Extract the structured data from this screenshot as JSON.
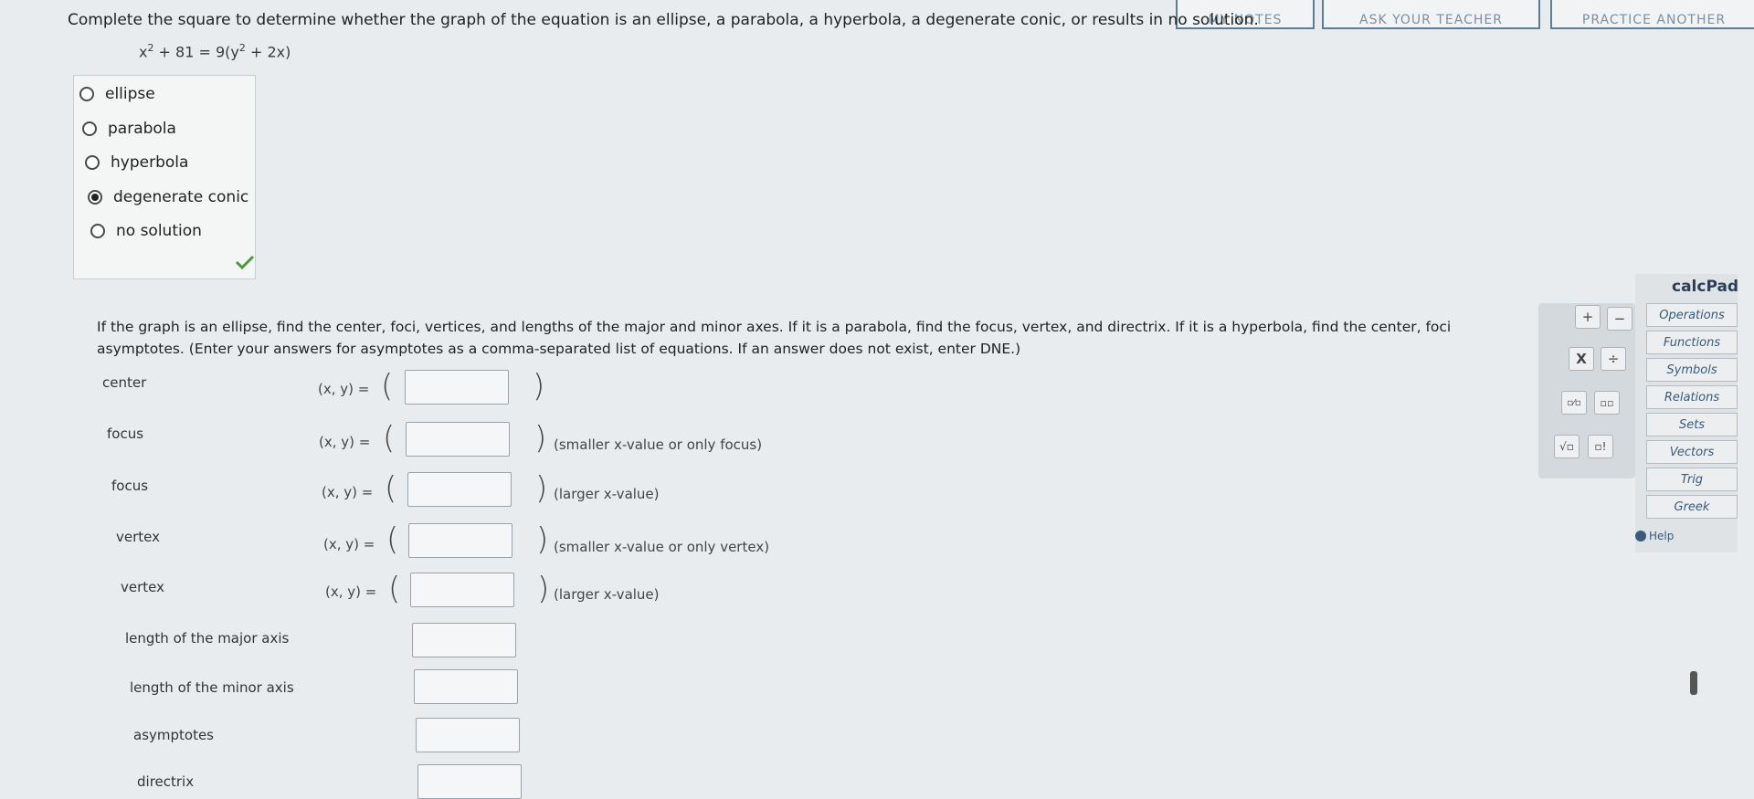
{
  "top_tabs": [
    "MY NOTES",
    "ASK YOUR TEACHER",
    "PRACTICE ANOTHER"
  ],
  "question": {
    "prompt": "Complete the square to determine whether the graph of the equation is an ellipse, a parabola, a hyperbola, a degenerate conic, or results in no solution.",
    "equation": {
      "lhs_base": "x",
      "lhs_exp": "2",
      "lhs_rest": " + 81 = 9(y",
      "rhs_exp": "2",
      "rhs_rest": " + 2x)"
    }
  },
  "choices": [
    {
      "label": "ellipse",
      "selected": false
    },
    {
      "label": "parabola",
      "selected": false
    },
    {
      "label": "hyperbola",
      "selected": false
    },
    {
      "label": "degenerate conic",
      "selected": true
    },
    {
      "label": "no solution",
      "selected": false
    }
  ],
  "instructions": "If the graph is an ellipse, find the center, foci, vertices, and lengths of the major and minor axes. If it is a parabola, find the focus, vertex, and directrix. If it is a hyperbola, find the center, foci, vertices, and asymptotes. (Enter your answers for asymptotes as a comma-separated list of equations. If an answer does not exist, enter DNE.)",
  "instructions_visible": "If the graph is an ellipse, find the center, foci, vertices, and lengths of the major and minor axes. If it is a parabola, find the focus, vertex, and directrix. If it is a hyperbola, find the center, foci",
  "instructions_line2": "asymptotes. (Enter your answers for asymptotes as a comma-separated list of equations. If an answer does not exist, enter DNE.)",
  "xy_label": "(x, y) =",
  "rows": [
    {
      "label": "center",
      "hint": ""
    },
    {
      "label": "focus",
      "hint": "(smaller x-value or only focus)"
    },
    {
      "label": "focus",
      "hint": "(larger x-value)"
    },
    {
      "label": "vertex",
      "hint": "(smaller x-value or only vertex)"
    },
    {
      "label": "vertex",
      "hint": "(larger x-value)"
    },
    {
      "label": "length of the major axis"
    },
    {
      "label": "length of the minor axis"
    },
    {
      "label": "asymptotes"
    },
    {
      "label": "directrix"
    }
  ],
  "calcpad": {
    "title": "calcPad",
    "buttons": [
      "+",
      "−",
      "X",
      "÷",
      "▫⁄▫",
      "▫▫",
      "√▫",
      "▫!"
    ],
    "categories": [
      "Operations",
      "Functions",
      "Symbols",
      "Relations",
      "Sets",
      "Vectors",
      "Trig",
      "Greek"
    ],
    "help": "Help"
  }
}
